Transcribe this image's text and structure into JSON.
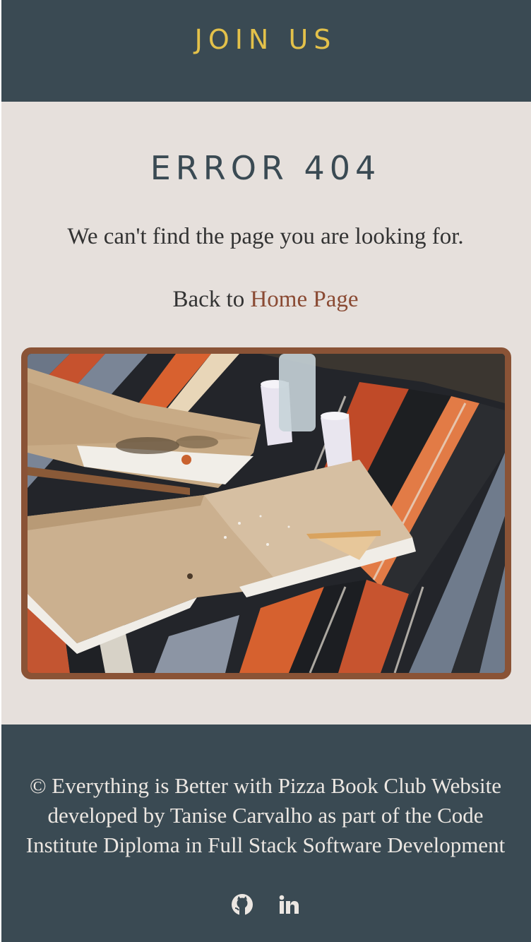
{
  "header": {
    "join_label": "JOIN US"
  },
  "main": {
    "title": "ERROR 404",
    "message": "We can't find the page you are looking for.",
    "back_prefix": "Back to ",
    "home_link": "Home Page"
  },
  "footer": {
    "copyright": "© Everything is Better with Pizza Book Club",
    "credit": "Website developed by Tanise Carvalho as part of the Code Institute Diploma in Full Stack Software Development",
    "social": [
      {
        "icon": "github-icon"
      },
      {
        "icon": "linkedin-icon"
      }
    ]
  },
  "colors": {
    "bar": "#3a4a53",
    "accent": "#e3c14a",
    "background": "#e6e0dc",
    "link": "#8a4a33",
    "frame": "#8a5336"
  }
}
